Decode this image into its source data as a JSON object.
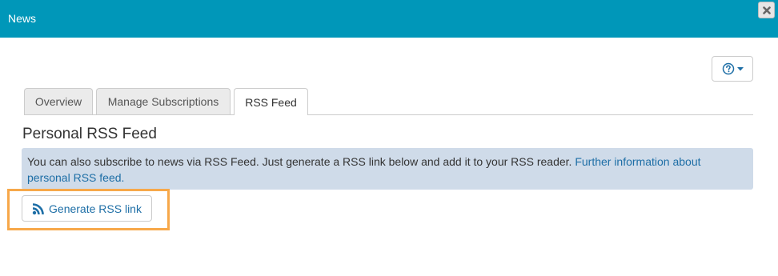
{
  "window": {
    "title": "News",
    "close_icon": "close-icon",
    "titlebar_color": "#0097b9"
  },
  "help_button": {
    "icon": "question-circle-icon",
    "dropdown_icon": "caret-down-icon"
  },
  "tabs": [
    {
      "label": "Overview",
      "active": false
    },
    {
      "label": "Manage Subscriptions",
      "active": false
    },
    {
      "label": "RSS Feed",
      "active": true
    }
  ],
  "main": {
    "section_title": "Personal RSS Feed",
    "info_text": "You can also subscribe to news via RSS Feed. Just generate a RSS link below and add it to your RSS reader.",
    "info_link": "Further information about personal RSS feed.",
    "generate_button": {
      "icon": "rss-icon",
      "label": "Generate RSS link"
    },
    "highlight_color": "#f7a84a",
    "link_color": "#1d6ea6"
  }
}
